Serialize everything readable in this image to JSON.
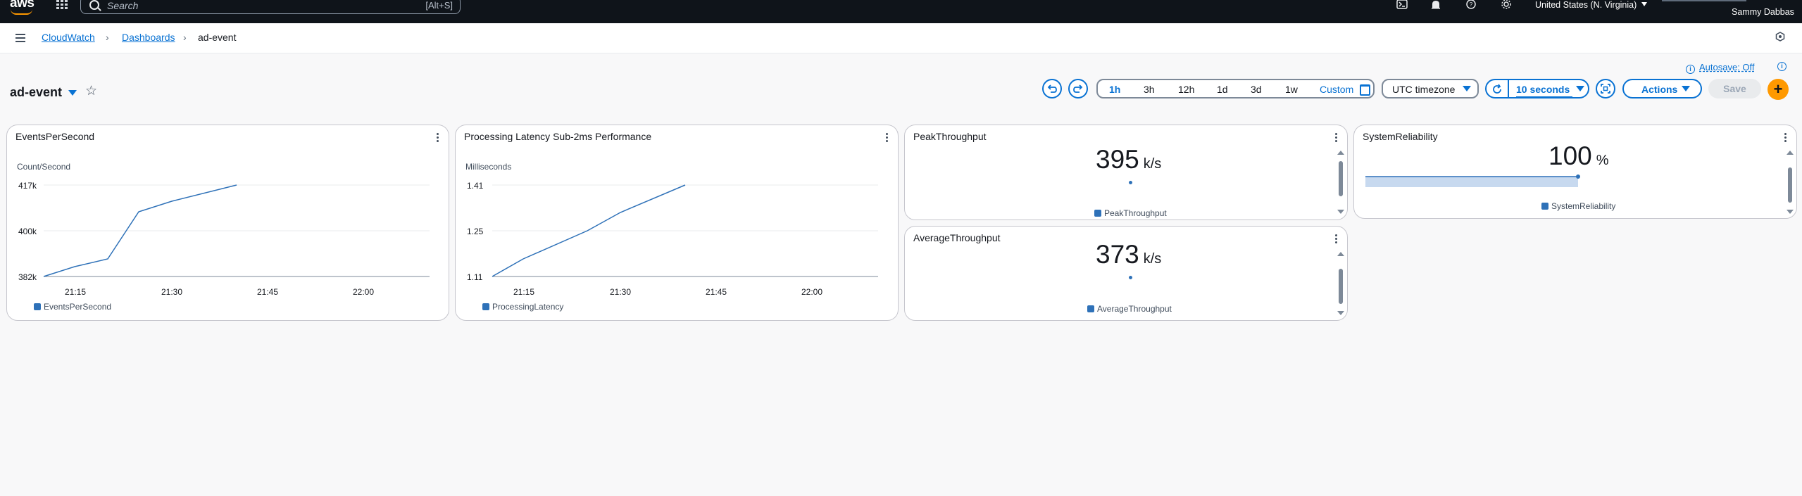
{
  "nav": {
    "logo": "aws",
    "search_placeholder": "Search",
    "search_shortcut": "[Alt+S]",
    "region": "United States (N. Virginia)",
    "user": "Sammy Dabbas"
  },
  "breadcrumb": {
    "items": [
      "CloudWatch",
      "Dashboards",
      "ad-event"
    ]
  },
  "toolbar": {
    "autosave": "Autosave: Off",
    "ranges": [
      "1h",
      "3h",
      "12h",
      "1d",
      "3d",
      "1w",
      "Custom"
    ],
    "active_range": "1h",
    "timezone": "UTC timezone",
    "refresh": "10 seconds",
    "actions": "Actions",
    "save": "Save",
    "add": "+"
  },
  "page": {
    "title": "ad-event"
  },
  "widgets": {
    "events": {
      "title": "EventsPerSecond",
      "unit": "Count/Second",
      "yticks": [
        "417k",
        "400k",
        "382k"
      ],
      "xticks": [
        "21:15",
        "21:30",
        "21:45",
        "22:00"
      ],
      "legend": "EventsPerSecond"
    },
    "latency": {
      "title": "Processing Latency Sub-2ms Performance",
      "unit": "Milliseconds",
      "yticks": [
        "1.41",
        "1.25",
        "1.11"
      ],
      "xticks": [
        "21:15",
        "21:30",
        "21:45",
        "22:00"
      ],
      "legend": "ProcessingLatency"
    },
    "peak": {
      "title": "PeakThroughput",
      "value": "395",
      "unit": "k/s",
      "legend": "PeakThroughput"
    },
    "average": {
      "title": "AverageThroughput",
      "value": "373",
      "unit": "k/s",
      "legend": "AverageThroughput"
    },
    "reliability": {
      "title": "SystemReliability",
      "value": "100",
      "unit": "%",
      "legend": "SystemReliability",
      "fill_fraction": 1.0
    }
  },
  "colors": {
    "accent": "#0972d3",
    "series": "#2e71b8",
    "nav_bg": "#0f141a",
    "add": "#ff9900"
  }
}
